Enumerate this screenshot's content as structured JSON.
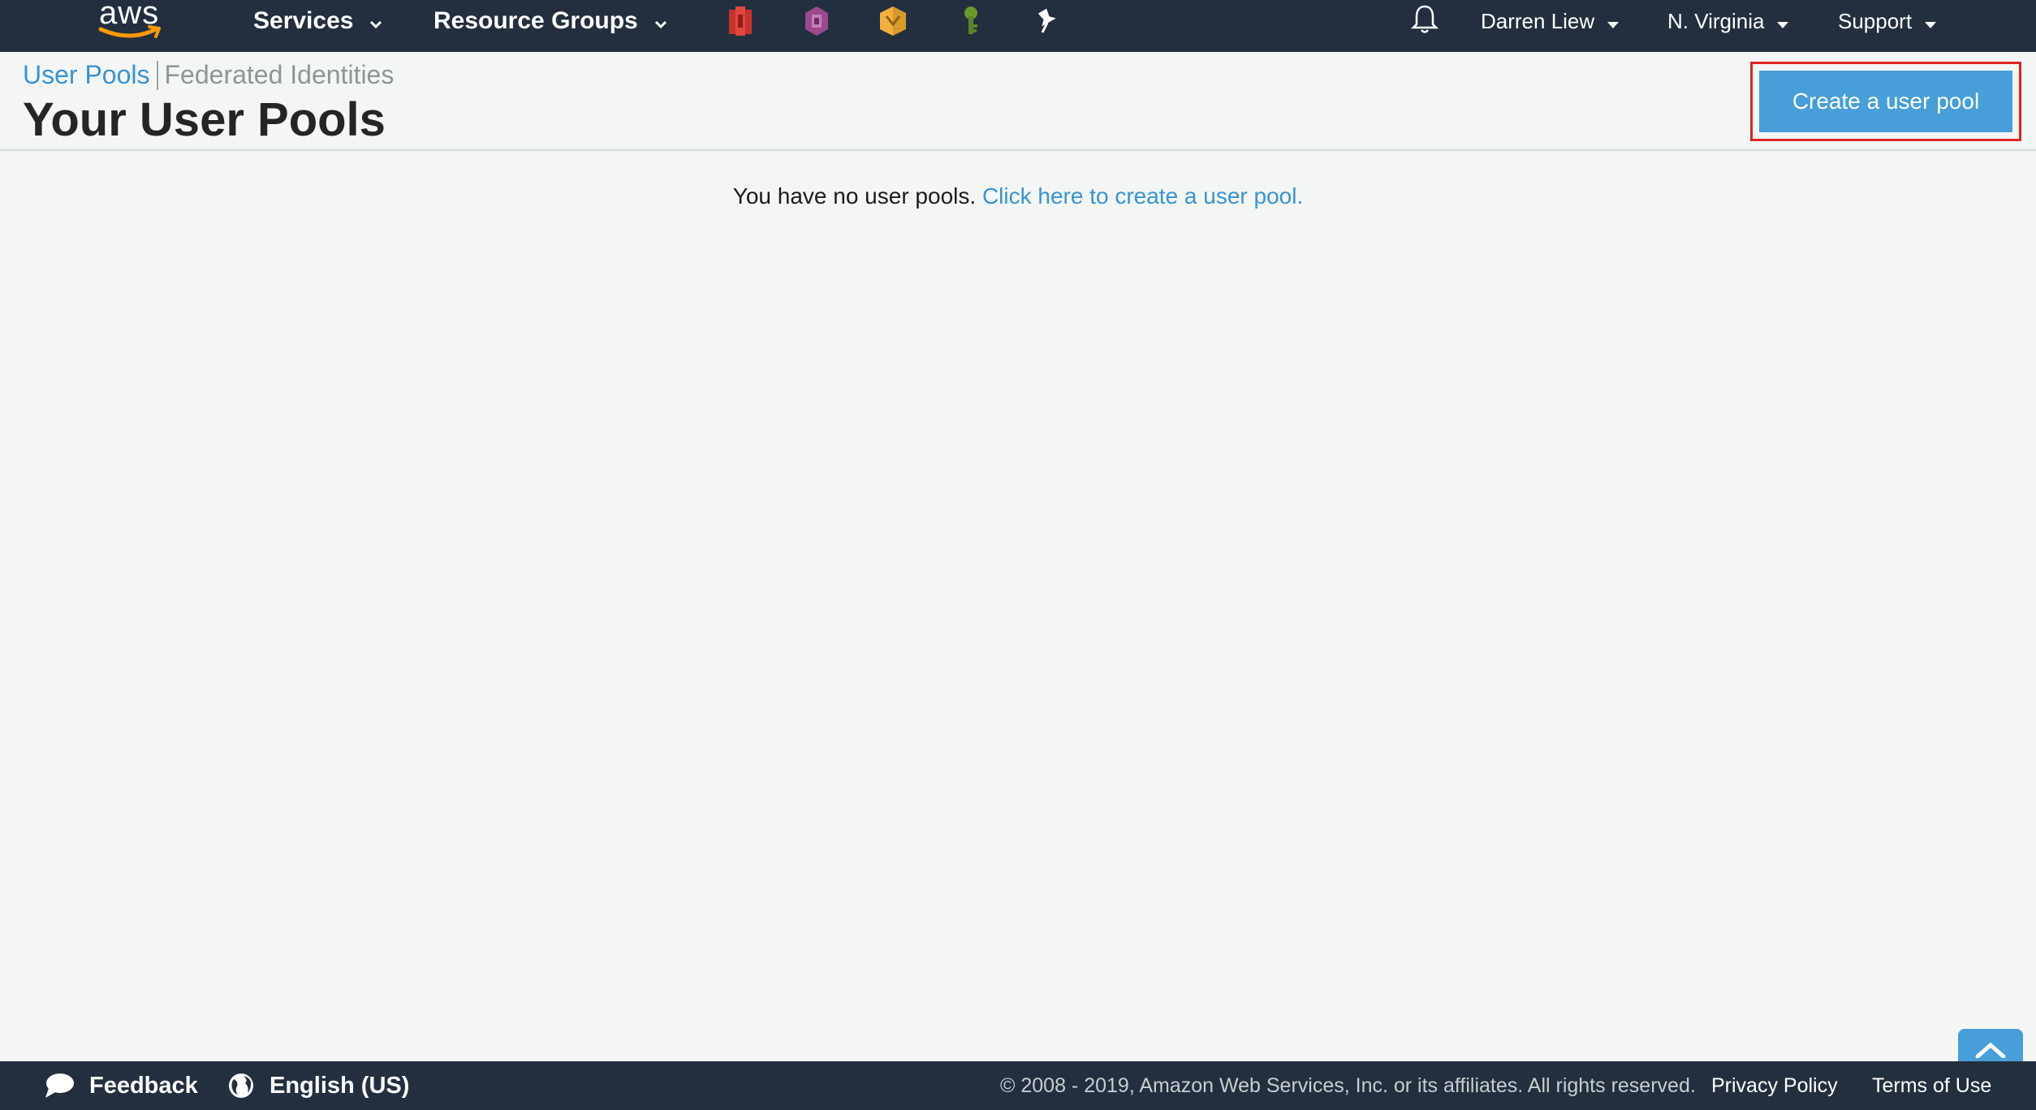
{
  "topnav": {
    "logo_text": "aws",
    "services_label": "Services",
    "resource_groups_label": "Resource Groups",
    "user_label": "Darren Liew",
    "region_label": "N. Virginia",
    "support_label": "Support",
    "pinned_icons": [
      "cloudformation-icon",
      "cognito-icon",
      "amplify-icon",
      "iam-key-icon",
      "pin-icon"
    ]
  },
  "header": {
    "tab_user_pools": "User Pools",
    "tab_federated": "Federated Identities",
    "title": "Your User Pools",
    "create_button": "Create a user pool"
  },
  "main": {
    "empty_message": "You have no user pools.",
    "empty_link": "Click here to create a user pool."
  },
  "footer": {
    "feedback_label": "Feedback",
    "language_label": "English (US)",
    "copyright": "© 2008 - 2019, Amazon Web Services, Inc. or its affiliates. All rights reserved.",
    "privacy_label": "Privacy Policy",
    "terms_label": "Terms of Use"
  },
  "colors": {
    "nav_bg": "#232f3e",
    "accent": "#479ed8",
    "link": "#3a93d3",
    "highlight_border": "#e02424"
  }
}
